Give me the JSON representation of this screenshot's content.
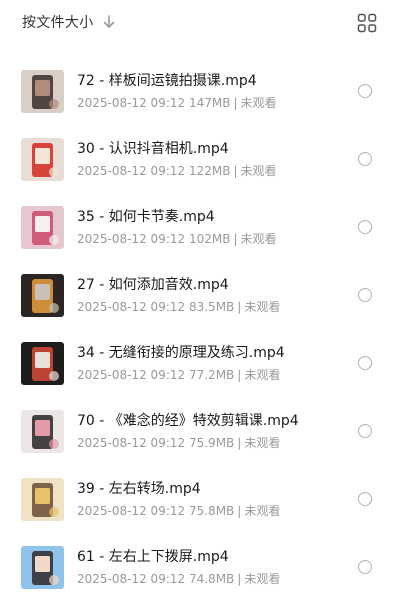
{
  "toolbar": {
    "sort_label": "按文件大小",
    "sort_icon": "arrow-down-icon",
    "view_icon": "grid-view-icon"
  },
  "files": [
    {
      "name": "72 - 样板间运镜拍摄课.mp4",
      "date": "2025-08-12 09:12",
      "size": "147MB",
      "status": "未观看",
      "thumb_colors": [
        "#d9cfc6",
        "#3a2e2a",
        "#b08c7a"
      ]
    },
    {
      "name": "30 - 认识抖音相机.mp4",
      "date": "2025-08-12 09:12",
      "size": "122MB",
      "status": "未观看",
      "thumb_colors": [
        "#e8ddd6",
        "#d4291f",
        "#f2e6d8"
      ]
    },
    {
      "name": "35 - 如何卡节奏.mp4",
      "date": "2025-08-12 09:12",
      "size": "102MB",
      "status": "未观看",
      "thumb_colors": [
        "#e6c7cf",
        "#c9486a",
        "#f4f0ee"
      ]
    },
    {
      "name": "27 - 如何添加音效.mp4",
      "date": "2025-08-12 09:12",
      "size": "83.5MB",
      "status": "未观看",
      "thumb_colors": [
        "#2b2624",
        "#e9a23b",
        "#c9c0b8"
      ]
    },
    {
      "name": "34 - 无缝衔接的原理及练习.mp4",
      "date": "2025-08-12 09:12",
      "size": "77.2MB",
      "status": "未观看",
      "thumb_colors": [
        "#1f1c1c",
        "#d94a3a",
        "#e8e0da"
      ]
    },
    {
      "name": "70 - 《难念的经》特效剪辑课.mp4",
      "date": "2025-08-12 09:12",
      "size": "75.9MB",
      "status": "未观看",
      "thumb_colors": [
        "#ece6e6",
        "#2a2424",
        "#e59aa8"
      ]
    },
    {
      "name": "39 - 左右转场.mp4",
      "date": "2025-08-12 09:12",
      "size": "75.8MB",
      "status": "未观看",
      "thumb_colors": [
        "#f0e2c4",
        "#6b4b35",
        "#e7c26a"
      ]
    },
    {
      "name": "61 - 左右上下拨屏.mp4",
      "date": "2025-08-12 09:12",
      "size": "74.8MB",
      "status": "未观看",
      "thumb_colors": [
        "#8fc3ea",
        "#2f2a2a",
        "#f0d9c8"
      ]
    }
  ]
}
